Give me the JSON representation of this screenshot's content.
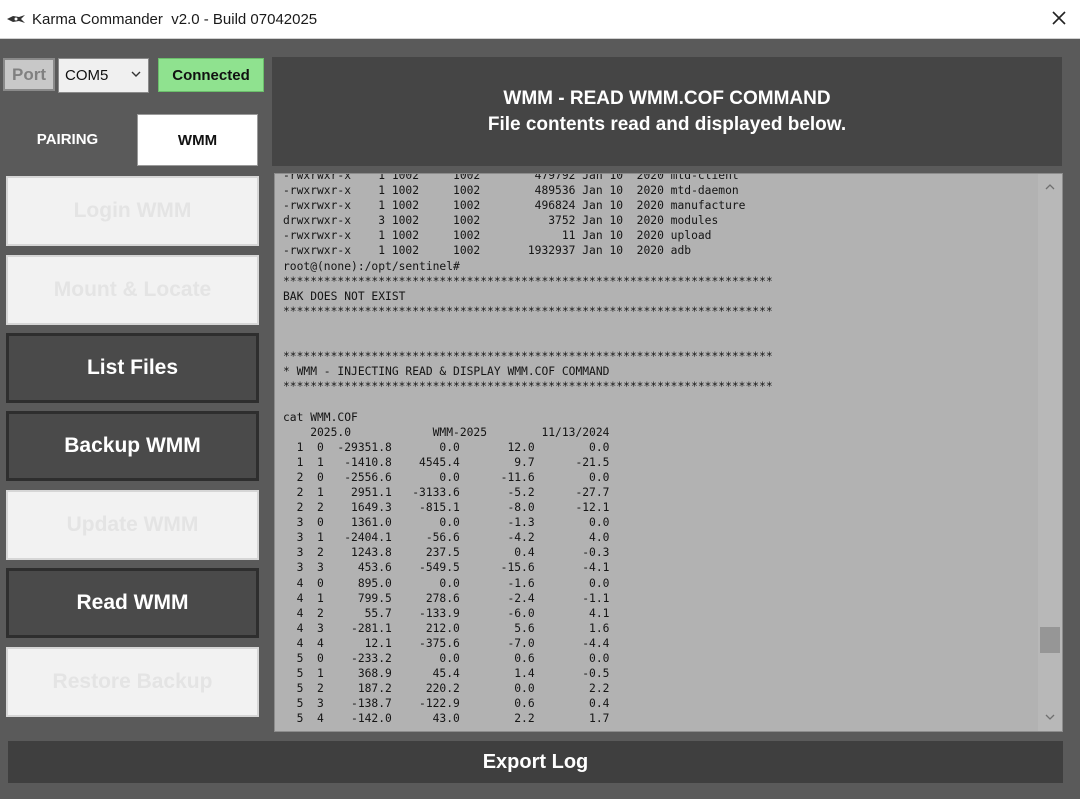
{
  "window": {
    "title": "Karma Commander  v2.0 - Build 07042025"
  },
  "connection": {
    "port_label": "Port",
    "com_port": "COM5",
    "status": "Connected"
  },
  "header": {
    "line1": "WMM - READ WMM.COF COMMAND",
    "line2": "File contents read and displayed below."
  },
  "tabs": [
    {
      "label": "PAIRING",
      "selected": false
    },
    {
      "label": "WMM",
      "selected": true
    }
  ],
  "buttons": {
    "login": "Login WMM",
    "mount": "Mount & Locate",
    "list": "List Files",
    "backup": "Backup WMM",
    "update": "Update WMM",
    "read": "Read WMM",
    "restore": "Restore Backup",
    "export": "Export Log"
  },
  "log": {
    "lines": [
      "-rwxrwxr-x    1 1002     1002        479792 Jan 10  2020 mtd-client",
      "-rwxrwxr-x    1 1002     1002        489536 Jan 10  2020 mtd-daemon",
      "-rwxrwxr-x    1 1002     1002        496824 Jan 10  2020 manufacture",
      "drwxrwxr-x    3 1002     1002          3752 Jan 10  2020 modules",
      "-rwxrwxr-x    1 1002     1002            11 Jan 10  2020 upload",
      "-rwxrwxr-x    1 1002     1002       1932937 Jan 10  2020 adb",
      "root@(none):/opt/sentinel#",
      "************************************************************************",
      "BAK DOES NOT EXIST",
      "************************************************************************",
      "",
      "",
      "************************************************************************",
      "* WMM - INJECTING READ & DISPLAY WMM.COF COMMAND",
      "************************************************************************",
      "",
      "cat WMM.COF",
      "    2025.0            WMM-2025        11/13/2024",
      "  1  0  -29351.8       0.0       12.0        0.0",
      "  1  1   -1410.8    4545.4        9.7      -21.5",
      "  2  0   -2556.6       0.0      -11.6        0.0",
      "  2  1    2951.1   -3133.6       -5.2      -27.7",
      "  2  2    1649.3    -815.1       -8.0      -12.1",
      "  3  0    1361.0       0.0       -1.3        0.0",
      "  3  1   -2404.1     -56.6       -4.2        4.0",
      "  3  2    1243.8     237.5        0.4       -0.3",
      "  3  3     453.6    -549.5      -15.6       -4.1",
      "  4  0     895.0       0.0       -1.6        0.0",
      "  4  1     799.5     278.6       -2.4       -1.1",
      "  4  2      55.7    -133.9       -6.0        4.1",
      "  4  3    -281.1     212.0        5.6        1.6",
      "  4  4      12.1    -375.6       -7.0       -4.4",
      "  5  0    -233.2       0.0        0.6        0.0",
      "  5  1     368.9      45.4        1.4       -0.5",
      "  5  2     187.2     220.2        0.0        2.2",
      "  5  3    -138.7    -122.9        0.6        0.4",
      "  5  4    -142.0      43.0        2.2        1.7"
    ]
  },
  "colors": {
    "background": "#5a5a5a",
    "connected": "#8fe28f",
    "header_panel": "#454545",
    "log_background": "#b2b2b2"
  },
  "icons": [
    "app-icon",
    "close-icon",
    "chevron-down-icon",
    "scroll-up-icon",
    "scroll-down-icon"
  ]
}
